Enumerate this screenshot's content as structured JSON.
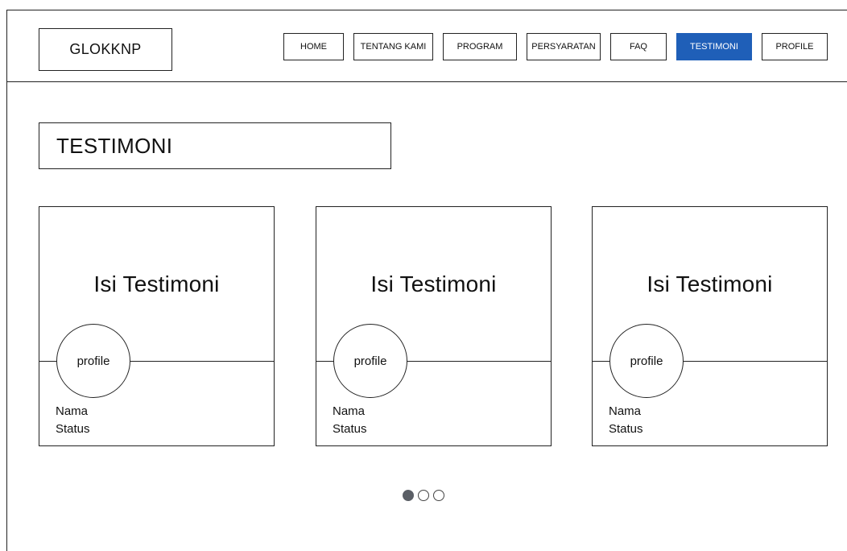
{
  "header": {
    "logo": "GLOKKNP",
    "nav": [
      {
        "label": "HOME",
        "active": false
      },
      {
        "label": "TENTANG KAMI",
        "active": false
      },
      {
        "label": "PROGRAM",
        "active": false
      },
      {
        "label": "PERSYARATAN",
        "active": false
      },
      {
        "label": "FAQ",
        "active": false
      },
      {
        "label": "TESTIMONI",
        "active": true
      },
      {
        "label": "PROFILE",
        "active": false
      }
    ]
  },
  "main": {
    "title": "TESTIMONI",
    "cards": [
      {
        "text": "Isi Testimoni",
        "avatar": "profile",
        "name": "Nama",
        "status": "Status"
      },
      {
        "text": "Isi Testimoni",
        "avatar": "profile",
        "name": "Nama",
        "status": "Status"
      },
      {
        "text": "Isi Testimoni",
        "avatar": "profile",
        "name": "Nama",
        "status": "Status"
      }
    ],
    "pagination": {
      "count": 3,
      "active_index": 0
    }
  },
  "colors": {
    "active_nav_bg": "#1f5fb8",
    "active_dot": "#5b5f66"
  }
}
